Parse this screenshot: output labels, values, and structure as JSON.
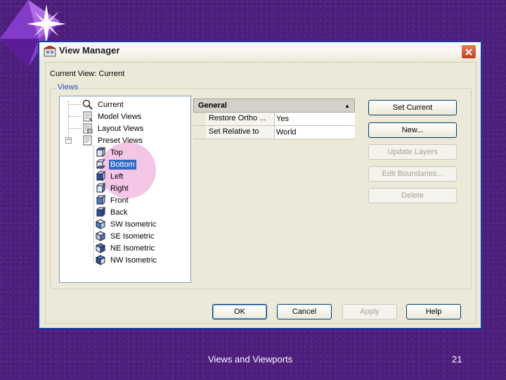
{
  "window": {
    "title": "View Manager"
  },
  "current_view": {
    "text": "Current View: Current"
  },
  "views_group": {
    "label": "Views"
  },
  "tree": {
    "items": [
      {
        "label": "Current",
        "icon": "magnifier-icon"
      },
      {
        "label": "Model Views",
        "icon": "model-views-icon"
      },
      {
        "label": "Layout Views",
        "icon": "layout-views-icon"
      },
      {
        "label": "Preset Views",
        "icon": "preset-views-icon"
      },
      {
        "label": "Top",
        "icon": "cube-top-icon"
      },
      {
        "label": "Bottom",
        "icon": "cube-bottom-icon"
      },
      {
        "label": "Left",
        "icon": "cube-left-icon"
      },
      {
        "label": "Right",
        "icon": "cube-right-icon"
      },
      {
        "label": "Front",
        "icon": "cube-front-icon"
      },
      {
        "label": "Back",
        "icon": "cube-back-icon"
      },
      {
        "label": "SW Isometric",
        "icon": "iso-sw-icon"
      },
      {
        "label": "SE Isometric",
        "icon": "iso-se-icon"
      },
      {
        "label": "NE Isometric",
        "icon": "iso-ne-icon"
      },
      {
        "label": "NW Isometric",
        "icon": "iso-nw-icon"
      }
    ],
    "selected": "Bottom"
  },
  "properties": {
    "header": "General",
    "rows": [
      {
        "name": "Restore Ortho ...",
        "value": "Yes"
      },
      {
        "name": "Set Relative to",
        "value": "World"
      }
    ]
  },
  "side_buttons": {
    "set_current": "Set Current",
    "new": "New...",
    "update_layers": "Update Layers",
    "edit_boundaries": "Edit Boundaries...",
    "delete": "Delete"
  },
  "bottom_buttons": {
    "ok": "OK",
    "cancel": "Cancel",
    "apply": "Apply",
    "help": "Help"
  },
  "footer": {
    "title": "Views and Viewports",
    "page": "21"
  },
  "colors": {
    "background": "#4e1e7e",
    "dialog": "#ece9d8",
    "selection": "#316ac5",
    "highlight": "#ec96d2"
  }
}
